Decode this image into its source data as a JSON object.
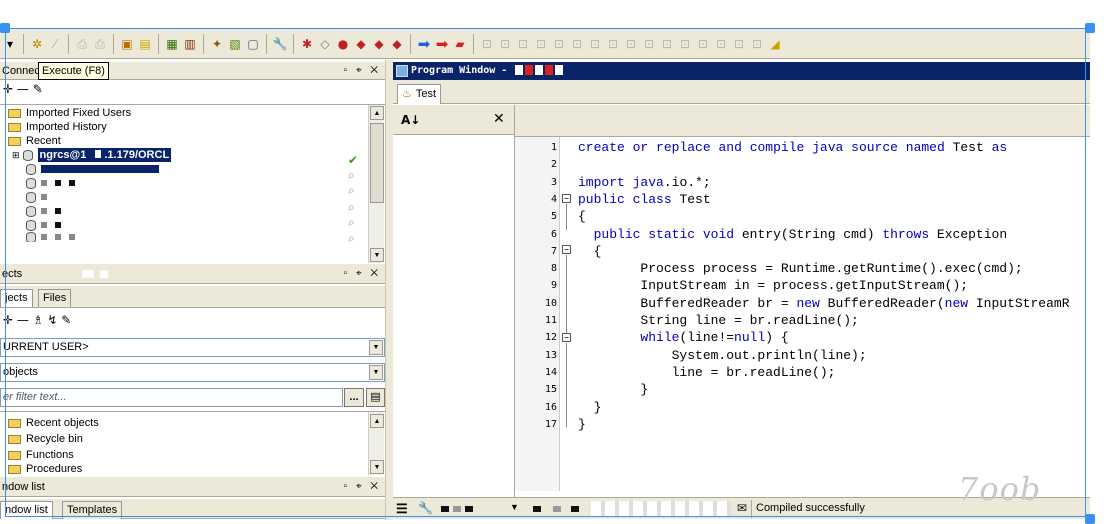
{
  "colors": {
    "accent": "#3b8ff0",
    "title_bar": "#0a246a",
    "keyword": "#0000c0",
    "chrome": "#ece9d8"
  },
  "toolbar": {
    "icons": [
      "dropdown-arrow-icon",
      "gear-icon",
      "wand-icon",
      "printer-icon",
      "printer-setup-icon",
      "sql-window-icon",
      "sql-new-icon",
      "command-window-icon",
      "report-icon",
      "explain-plan-icon",
      "beautifier-icon",
      "new-window-icon",
      "wrench-icon",
      "break-icon",
      "clear-icon",
      "stop-icon",
      "bookmark-icon",
      "bookmark-next-icon",
      "execute-arrow-icon",
      "step-arrow-icon",
      "car-icon"
    ]
  },
  "connections_panel": {
    "title": "Connecti",
    "tooltip": "Execute (F8)",
    "tree": [
      {
        "type": "folder",
        "label": "Imported Fixed Users"
      },
      {
        "type": "folder",
        "label": "Imported History"
      },
      {
        "type": "folder",
        "label": "Recent"
      },
      {
        "type": "db",
        "label": "ngrcs@1",
        "suffix": ".1.179/ORCL",
        "selected": true
      }
    ]
  },
  "objects_panel": {
    "title": "ects",
    "tabs": [
      "jects",
      "Files"
    ],
    "user_select": "URRENT USER>",
    "objects_select": "objects",
    "filter_placeholder": "er filter text...",
    "filter_btn": "...",
    "tree": [
      "Recent objects",
      "Recycle bin",
      "Functions",
      "Procedures"
    ]
  },
  "window_list_panel": {
    "title": "ndow list",
    "tabs": [
      "ndow list",
      "Templates"
    ]
  },
  "program_window": {
    "title": "Program Window - ",
    "tab": "Test",
    "lines": [
      {
        "n": "1",
        "text": "create or replace and compile java source named Test as"
      },
      {
        "n": "2",
        "text": ""
      },
      {
        "n": "3",
        "text": "import java.io.*;"
      },
      {
        "n": "4",
        "text": "public class Test"
      },
      {
        "n": "5",
        "text": "{"
      },
      {
        "n": "6",
        "text": "  public static void entry(String cmd) throws Exception"
      },
      {
        "n": "7",
        "text": "  {"
      },
      {
        "n": "8",
        "text": "        Process process = Runtime.getRuntime().exec(cmd);"
      },
      {
        "n": "9",
        "text": "        InputStream in = process.getInputStream();"
      },
      {
        "n": "10",
        "text": "        BufferedReader br = new BufferedReader(new InputStreamR"
      },
      {
        "n": "11",
        "text": "        String line = br.readLine();"
      },
      {
        "n": "12",
        "text": "        while(line!=null) {"
      },
      {
        "n": "13",
        "text": "            System.out.println(line);"
      },
      {
        "n": "14",
        "text": "            line = br.readLine();"
      },
      {
        "n": "15",
        "text": "        }"
      },
      {
        "n": "16",
        "text": "  }"
      },
      {
        "n": "17",
        "text": "}"
      }
    ],
    "status": "Compiled successfully"
  },
  "watermark": "7oob"
}
